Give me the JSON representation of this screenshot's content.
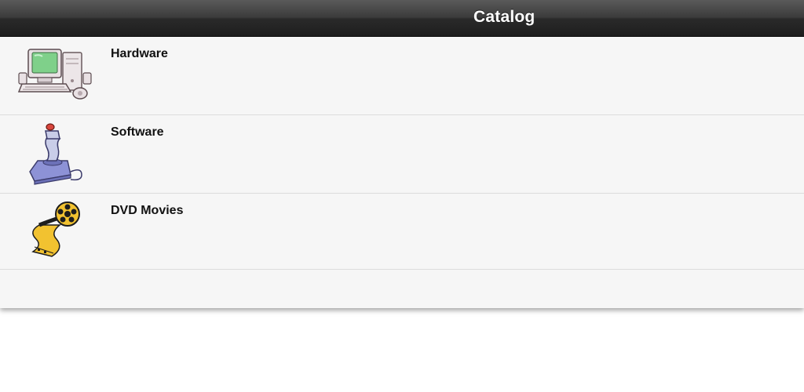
{
  "toolbar": {
    "title": "Catalog"
  },
  "catalog": {
    "items": [
      {
        "label": "Hardware",
        "icon": "computer-icon"
      },
      {
        "label": "Software",
        "icon": "joystick-icon"
      },
      {
        "label": "DVD Movies",
        "icon": "film-reel-icon"
      }
    ]
  },
  "colors": {
    "toolbar_top": "#5a5a5a",
    "toolbar_bottom": "#1e1e1e",
    "list_background": "#f6f6f6",
    "separator": "#dcdcdc",
    "label_text": "#111111",
    "title_text": "#ffffff"
  }
}
